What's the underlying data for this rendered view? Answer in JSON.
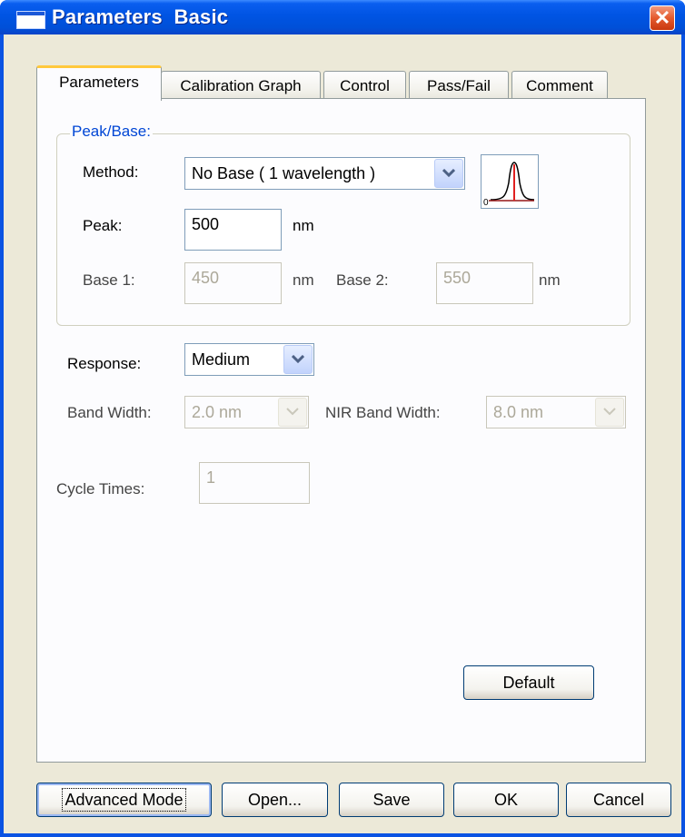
{
  "window": {
    "title": "Parameters  Basic",
    "close_glyph": "✕"
  },
  "tabs": [
    {
      "label": "Parameters",
      "active": true
    },
    {
      "label": "Calibration Graph",
      "active": false
    },
    {
      "label": "Control",
      "active": false
    },
    {
      "label": "Pass/Fail",
      "active": false
    },
    {
      "label": "Comment",
      "active": false
    }
  ],
  "peak_base": {
    "group_label": "Peak/Base:",
    "method_label": "Method:",
    "method_value": "No Base ( 1 wavelength )",
    "peak_label": "Peak:",
    "peak_value": "500",
    "peak_unit": "nm",
    "base1_label": "Base 1:",
    "base1_value": "450",
    "base1_unit": "nm",
    "base2_label": "Base 2:",
    "base2_value": "550",
    "base2_unit": "nm",
    "method_icon": "peak-curve-icon",
    "icon_zero": "0"
  },
  "response": {
    "label": "Response:",
    "value": "Medium"
  },
  "band_width": {
    "label": "Band Width:",
    "value": "2.0 nm"
  },
  "nir_band_width": {
    "label": "NIR Band Width:",
    "value": "8.0 nm"
  },
  "cycle_times": {
    "label": "Cycle Times:",
    "value": "1"
  },
  "buttons": {
    "default": "Default",
    "advanced_mode": "Advanced Mode",
    "open": "Open...",
    "save": "Save",
    "ok": "OK",
    "cancel": "Cancel"
  },
  "colors": {
    "title_bar": "#0054e3",
    "group_label": "#0046d5",
    "peak_line": "#e02020",
    "dialog_bg": "#ece9d8"
  }
}
